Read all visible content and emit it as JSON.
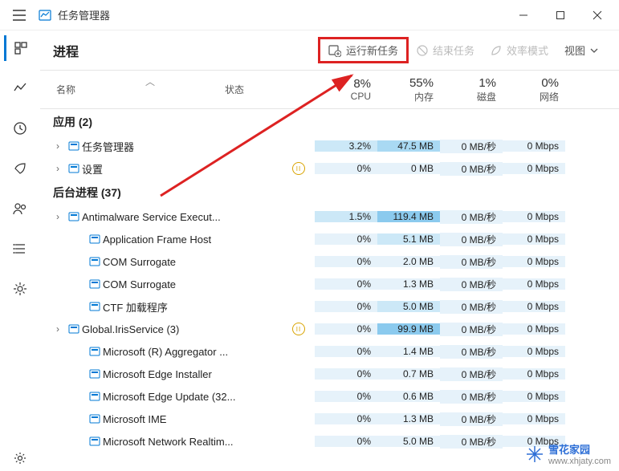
{
  "app": {
    "title": "任务管理器"
  },
  "toolbar": {
    "page_title": "进程",
    "run_new_task": "运行新任务",
    "end_task": "结束任务",
    "efficiency_mode": "效率模式",
    "view": "视图"
  },
  "columns": {
    "name": "名称",
    "status": "状态",
    "cpu": {
      "pct": "8%",
      "label": "CPU"
    },
    "mem": {
      "pct": "55%",
      "label": "内存"
    },
    "disk": {
      "pct": "1%",
      "label": "磁盘"
    },
    "net": {
      "pct": "0%",
      "label": "网络"
    }
  },
  "groups": {
    "apps": {
      "title": "应用 (2)"
    },
    "bg": {
      "title": "后台进程 (37)"
    }
  },
  "rows": [
    {
      "name": "任务管理器",
      "expand": true,
      "cpu": "3.2%",
      "mem": "47.5 MB",
      "disk": "0 MB/秒",
      "net": "0 Mbps",
      "cpu_h": 2,
      "mem_h": 3
    },
    {
      "name": "设置",
      "expand": true,
      "paused": true,
      "cpu": "0%",
      "mem": "0 MB",
      "disk": "0 MB/秒",
      "net": "0 Mbps",
      "cpu_h": 1,
      "mem_h": 1
    },
    {
      "name": "Antimalware Service Execut...",
      "expand": true,
      "cpu": "1.5%",
      "mem": "119.4 MB",
      "disk": "0 MB/秒",
      "net": "0 Mbps",
      "cpu_h": 2,
      "mem_h": 4
    },
    {
      "name": "Application Frame Host",
      "cpu": "0%",
      "mem": "5.1 MB",
      "disk": "0 MB/秒",
      "net": "0 Mbps",
      "cpu_h": 1,
      "mem_h": 2
    },
    {
      "name": "COM Surrogate",
      "cpu": "0%",
      "mem": "2.0 MB",
      "disk": "0 MB/秒",
      "net": "0 Mbps",
      "cpu_h": 1,
      "mem_h": 1
    },
    {
      "name": "COM Surrogate",
      "cpu": "0%",
      "mem": "1.3 MB",
      "disk": "0 MB/秒",
      "net": "0 Mbps",
      "cpu_h": 1,
      "mem_h": 1
    },
    {
      "name": "CTF 加载程序",
      "cpu": "0%",
      "mem": "5.0 MB",
      "disk": "0 MB/秒",
      "net": "0 Mbps",
      "cpu_h": 1,
      "mem_h": 2
    },
    {
      "name": "Global.IrisService (3)",
      "expand": true,
      "paused": true,
      "cpu": "0%",
      "mem": "99.9 MB",
      "disk": "0 MB/秒",
      "net": "0 Mbps",
      "cpu_h": 1,
      "mem_h": 4
    },
    {
      "name": "Microsoft (R) Aggregator ...",
      "cpu": "0%",
      "mem": "1.4 MB",
      "disk": "0 MB/秒",
      "net": "0 Mbps",
      "cpu_h": 1,
      "mem_h": 1
    },
    {
      "name": "Microsoft Edge Installer",
      "cpu": "0%",
      "mem": "0.7 MB",
      "disk": "0 MB/秒",
      "net": "0 Mbps",
      "cpu_h": 1,
      "mem_h": 1
    },
    {
      "name": "Microsoft Edge Update (32...",
      "cpu": "0%",
      "mem": "0.6 MB",
      "disk": "0 MB/秒",
      "net": "0 Mbps",
      "cpu_h": 1,
      "mem_h": 1
    },
    {
      "name": "Microsoft IME",
      "cpu": "0%",
      "mem": "1.3 MB",
      "disk": "0 MB/秒",
      "net": "0 Mbps",
      "cpu_h": 1,
      "mem_h": 1
    },
    {
      "name": "Microsoft Network Realtim...",
      "cpu": "0%",
      "mem": "5.0 MB",
      "disk": "0 MB/秒",
      "net": "0 Mbps",
      "cpu_h": 1,
      "mem_h": 1
    }
  ],
  "watermark": {
    "brand": "雪花家园",
    "url": "www.xhjaty.com"
  }
}
